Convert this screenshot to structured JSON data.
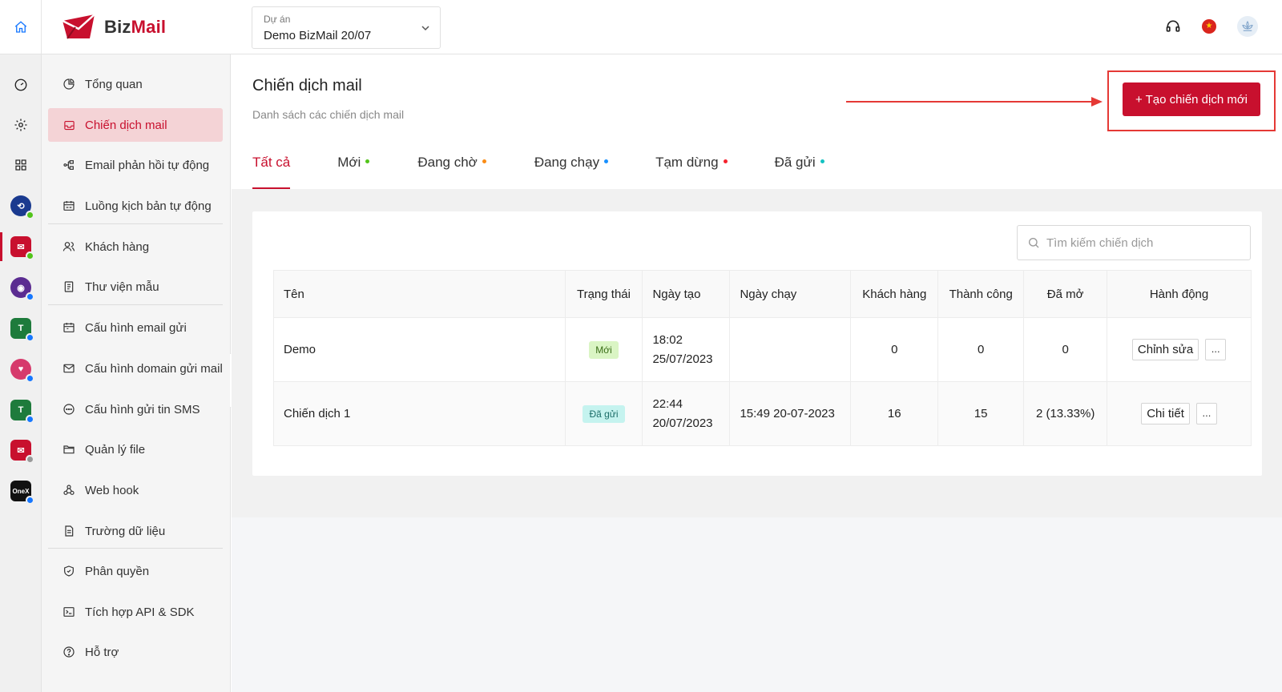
{
  "brand": {
    "name_part1": "Biz",
    "name_part2": "Mail",
    "accent": "#c8102e"
  },
  "project": {
    "label": "Dự án",
    "value": "Demo BizMail 20/07"
  },
  "header_icons": [
    "headset-icon",
    "vietnam-flag-icon",
    "user-avatar-icon"
  ],
  "rail": [
    {
      "name": "dashboard-gauge-icon"
    },
    {
      "name": "settings-gear-icon"
    },
    {
      "name": "apps-grid-icon"
    },
    {
      "name": "app-blue-loop",
      "color": "#1a3a8f"
    },
    {
      "name": "app-bizmail",
      "color": "#c8102e",
      "active": true
    },
    {
      "name": "app-purple-eye",
      "color": "#5b2c91"
    },
    {
      "name": "app-green-t",
      "color": "#1e7b3c"
    },
    {
      "name": "app-pink-heart",
      "color": "#d63a6c"
    },
    {
      "name": "app-green-t-2",
      "color": "#1e7b3c"
    },
    {
      "name": "app-red-mail",
      "color": "#c8102e"
    },
    {
      "name": "app-onex",
      "color": "#111111",
      "label": "OneX"
    }
  ],
  "menu": [
    {
      "label": "Tổng quan",
      "icon": "pie-chart-icon"
    },
    {
      "label": "Chiến dịch mail",
      "icon": "inbox-icon",
      "active": true
    },
    {
      "label": "Email phản hồi tự động",
      "icon": "flow-icon"
    },
    {
      "label": "Luồng kịch bản tự động",
      "icon": "calendar-flow-icon"
    },
    {
      "label": "Khách hàng",
      "icon": "users-icon"
    },
    {
      "label": "Thư viện mẫu",
      "icon": "template-icon"
    },
    {
      "label": "Cấu hình email gửi",
      "icon": "calendar-icon"
    },
    {
      "label": "Cấu hình domain gửi mail",
      "icon": "mail-icon"
    },
    {
      "label": "Cấu hình gửi tin SMS",
      "icon": "chat-icon"
    },
    {
      "label": "Quản lý file",
      "icon": "folder-icon"
    },
    {
      "label": "Web hook",
      "icon": "webhook-icon"
    },
    {
      "label": "Trường dữ liệu",
      "icon": "document-icon"
    },
    {
      "label": "Phân quyền",
      "icon": "shield-icon"
    },
    {
      "label": "Tích hợp API & SDK",
      "icon": "terminal-icon"
    },
    {
      "label": "Hỗ trợ",
      "icon": "help-icon"
    }
  ],
  "page": {
    "title": "Chiến dịch mail",
    "subtitle": "Danh sách các chiến dịch mail",
    "create_button": "+ Tạo chiến dịch mới"
  },
  "tabs": [
    {
      "label": "Tất cả",
      "active": true
    },
    {
      "label": "Mới",
      "dot_color": "#52c41a"
    },
    {
      "label": "Đang chờ",
      "dot_color": "#fa8c16"
    },
    {
      "label": "Đang chạy",
      "dot_color": "#1890ff"
    },
    {
      "label": "Tạm dừng",
      "dot_color": "#f5222d"
    },
    {
      "label": "Đã gửi",
      "dot_color": "#13c2c2"
    }
  ],
  "search": {
    "placeholder": "Tìm kiếm chiến dịch"
  },
  "table": {
    "columns": [
      "Tên",
      "Trạng thái",
      "Ngày tạo",
      "Ngày chạy",
      "Khách hàng",
      "Thành công",
      "Đã mở",
      "Hành động"
    ],
    "rows": [
      {
        "name": "Demo",
        "status": "Mới",
        "status_type": "new",
        "created_time": "18:02",
        "created_date": "25/07/2023",
        "run_at": "",
        "customers": "0",
        "success": "0",
        "opened": "0",
        "action": "Chỉnh sửa",
        "more": "..."
      },
      {
        "name": "Chiến dịch 1",
        "status": "Đã gửi",
        "status_type": "sent",
        "created_time": "22:44",
        "created_date": "20/07/2023",
        "run_at": "15:49 20-07-2023",
        "customers": "16",
        "success": "15",
        "opened": "2 (13.33%)",
        "action": "Chi tiết",
        "more": "..."
      }
    ]
  }
}
